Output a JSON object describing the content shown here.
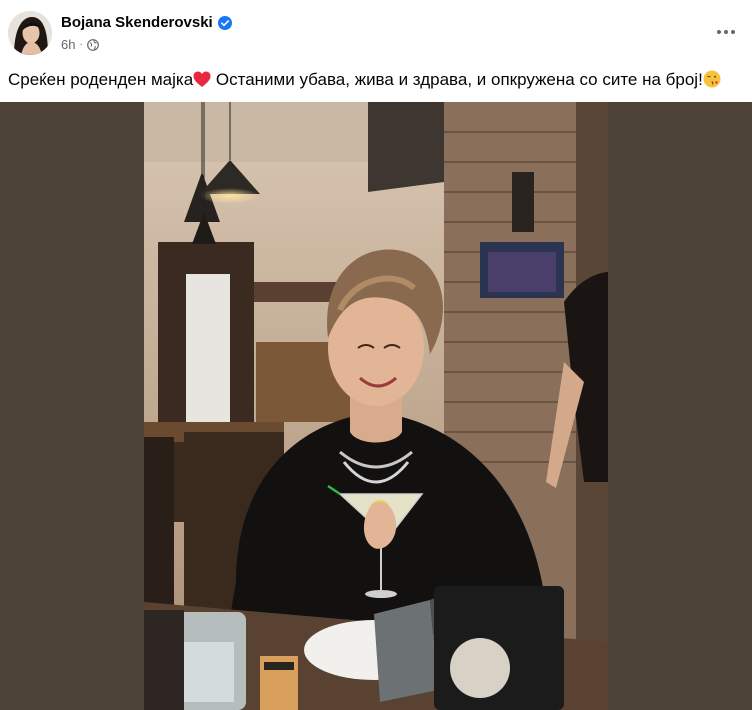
{
  "post": {
    "author_name": "Bojana Skenderovski",
    "time_ago": "6h",
    "separator": "·",
    "caption_part1": "Среќен роденден мајка",
    "caption_part2": " Останими убава, жива и здрава, и опкружена со сите на број!",
    "icons": {
      "verified": "verified-badge-icon",
      "audience": "globe-icon",
      "more": "more-options-icon",
      "heart": "red-heart-emoji",
      "kiss": "face-blowing-kiss-emoji"
    }
  },
  "colors": {
    "photo_backdrop": "#4d4339",
    "verified_blue": "#1877f2",
    "meta_gray": "#65676b",
    "text": "#050505"
  }
}
